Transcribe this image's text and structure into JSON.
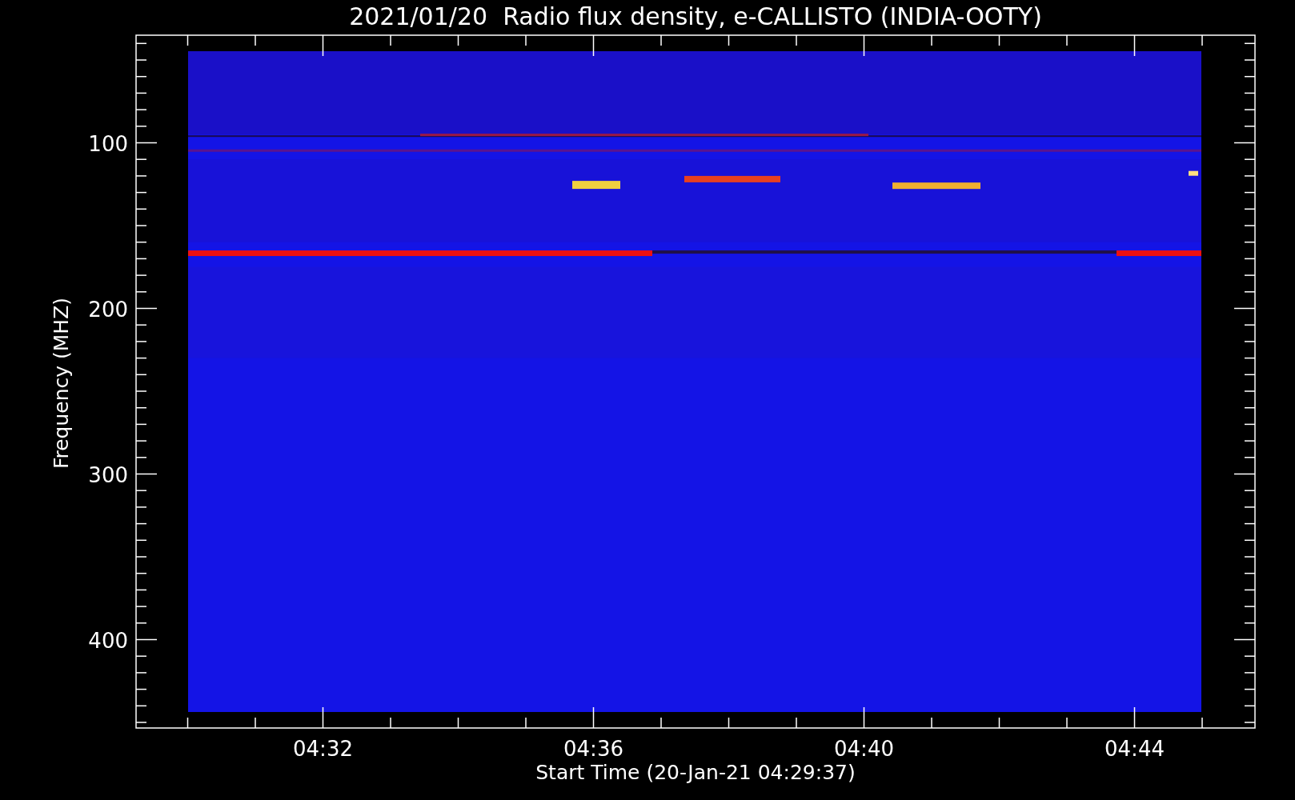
{
  "title": "2021/01/20  Radio flux density, e-CALLISTO (INDIA-OOTY)",
  "y_axis": {
    "label": "Frequency (MHZ)",
    "ticks": [
      {
        "label": "100"
      },
      {
        "label": "200"
      },
      {
        "label": "300"
      },
      {
        "label": "400"
      }
    ]
  },
  "x_axis": {
    "label": "Start Time (20-Jan-21 04:29:37)",
    "ticks": [
      {
        "label": "04:32"
      },
      {
        "label": "04:36"
      },
      {
        "label": "04:40"
      },
      {
        "label": "04:44"
      }
    ]
  }
}
